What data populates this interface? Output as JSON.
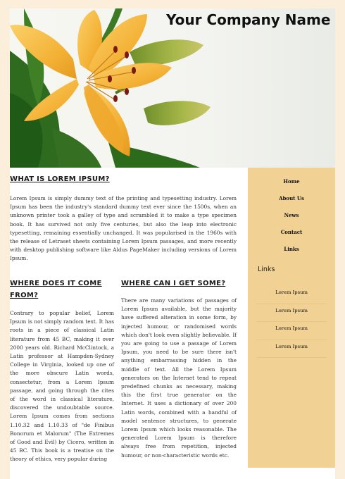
{
  "header": {
    "company_name": "Your Company Name"
  },
  "sections": {
    "what": {
      "title": "WHAT IS LOREM IPSUM?",
      "text": "Lorem Ipsum is simply dummy text of the printing and typesetting industry. Lorem Ipsum has been the industry's standard dummy text ever since the 1500s, when an unknown printer took a galley of type and scrambled it to make a type specimen book. It has survived not only five centuries, but also the leap into electronic typesetting, remaining essentially unchanged. It was popularised in the 1960s with the release of Letraset sheets containing Lorem Ipsum passages, and more recently with desktop publishing software like Aldus PageMaker including versions of Lorem Ipsum."
    },
    "where_from": {
      "title": "WHERE DOES IT COME FROM?",
      "text": "Contrary to popular belief, Lorem Ipsum is not simply random text. It has roots in a piece of classical Latin literature from 45 BC, making it over 2000 years old. Richard McClintock, a Latin professor at Hampden-Sydney College in Virginia, looked up one of the more obscure Latin words, consectetur, from a Lorem Ipsum passage, and going through the cites of the word in classical literature, discovered the undoubtable source. Lorem Ipsum comes from sections 1.10.32 and 1.10.33 of \"de Finibus Bonorum et Malorum\" (The Extremes of Good and Evil) by Cicero, written in 45 BC. This book is a treatise on the theory of ethics, very popular during"
    },
    "where_get": {
      "title": "WHERE CAN I GET SOME?",
      "text": "There are many variations of passages of Lorem Ipsum available, but the majority have suffered alteration in some form, by injected humour, or randomised words which don't look even slightly believable. If you are going to use a passage of Lorem Ipsum, you need to be sure there isn't anything embarrassing hidden in the middle of text. All the Lorem Ipsum generators on the Internet tend to repeat predefined chunks as necessary, making this the first true generator on the Internet. It uses a dictionary of over 200 Latin words, combined with a handful of model sentence structures, to generate Lorem Ipsum which looks reasonable. The generated Lorem Ipsum is therefore always free from repetition, injected humour, or non-characteristic words etc."
    }
  },
  "nav": [
    "Home",
    "About Us",
    "News",
    "Contact",
    "Links"
  ],
  "sidebar": {
    "links_title": "Links",
    "links": [
      "Lorem Ipsum",
      "Lorem Ipsum",
      "Lorem Ipsum",
      "Lorem Ipsum"
    ]
  },
  "colors": {
    "page_background": "#fbefdc",
    "sidebar_background": "#f1d294",
    "flower_petal": "#f4b338"
  },
  "icons": {
    "header_image": "lily-flower-image"
  }
}
